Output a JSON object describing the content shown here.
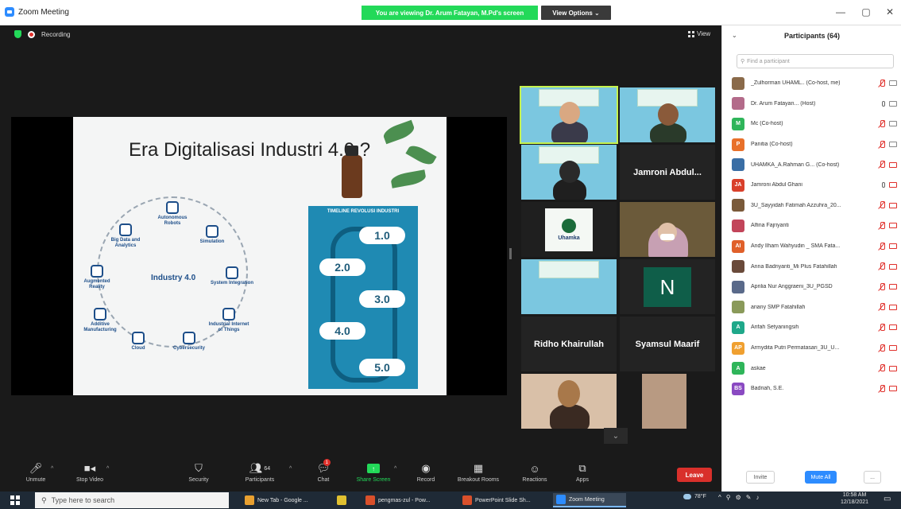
{
  "window": {
    "title": "Zoom Meeting",
    "viewing_banner": "You are viewing Dr. Arum Fatayan, M.Pd's screen",
    "view_options": "View Options ⌄",
    "minimize": "—",
    "maximize": "▢",
    "close": "✕"
  },
  "meeting": {
    "recording_label": "Recording",
    "view_label": "View"
  },
  "slide": {
    "title": "Era Digitalisasi Industri 4.0 ?",
    "center_label": "Industry 4.0",
    "nodes": [
      "Autonomous Robots",
      "Simulation",
      "System Integration",
      "Industrial Internet of Things",
      "Cybersecurity",
      "Cloud",
      "Additive Manufacturing",
      "Augmented Reality",
      "Big Data and Analytics"
    ],
    "timeline_title": "TIMELINE REVOLUSI INDUSTRI",
    "timeline_steps": [
      "1.0",
      "2.0",
      "3.0",
      "4.0",
      "5.0"
    ]
  },
  "tiles": [
    {
      "name": "",
      "type": "video"
    },
    {
      "name": "",
      "type": "video"
    },
    {
      "name": "",
      "type": "video"
    },
    {
      "name": "Jamroni Abdul...",
      "type": "name"
    },
    {
      "name": "",
      "type": "logo"
    },
    {
      "name": "",
      "type": "video"
    },
    {
      "name": "",
      "type": "video"
    },
    {
      "name": "N",
      "type": "avatar"
    },
    {
      "name": "Ridho Khairullah",
      "type": "name"
    },
    {
      "name": "Syamsul Maarif",
      "type": "name"
    },
    {
      "name": "",
      "type": "video"
    },
    {
      "name": "",
      "type": "video"
    }
  ],
  "logo_text": "Uhamka",
  "toolbar": {
    "unmute": "Unmute",
    "stop_video": "Stop Video",
    "security": "Security",
    "participants": "Participants",
    "participants_count": "64",
    "chat": "Chat",
    "chat_badge": "1",
    "share_screen": "Share Screen",
    "record": "Record",
    "breakout_rooms": "Breakout Rooms",
    "reactions": "Reactions",
    "apps": "Apps",
    "leave": "Leave"
  },
  "panel": {
    "title": "Participants (64)",
    "search_placeholder": "Find a participant",
    "invite": "Invite",
    "mute_all": "Mute All",
    "more": "...",
    "participants": [
      {
        "initials": "",
        "name": "_Zulhorman UHAML.. (Co-host, me)",
        "color": "#8a6a4a",
        "mic": "off",
        "cam": "on"
      },
      {
        "initials": "",
        "name": "Dr. Arum Fatayan... (Host)",
        "color": "#b36b8a",
        "mic": "on",
        "cam": "on"
      },
      {
        "initials": "M",
        "name": "Mc (Co-host)",
        "color": "#2fb55a",
        "mic": "off",
        "cam": "on"
      },
      {
        "initials": "P",
        "name": "Panitia (Co-host)",
        "color": "#e8702a",
        "mic": "off",
        "cam": "on"
      },
      {
        "initials": "",
        "name": "UHAMKA_A.Rahman G... (Co-host)",
        "color": "#3a6ea5",
        "mic": "off",
        "cam": "off"
      },
      {
        "initials": "JA",
        "name": "Jamroni Abdul Ghani",
        "color": "#d9402b",
        "mic": "on",
        "cam": "off"
      },
      {
        "initials": "",
        "name": "3U_Sayyidah Fatimah Azzuhra_20...",
        "color": "#7a5a3a",
        "mic": "off",
        "cam": "off"
      },
      {
        "initials": "",
        "name": "Alfina Fajriyanti",
        "color": "#c2455a",
        "mic": "off",
        "cam": "off"
      },
      {
        "initials": "AI",
        "name": "Andy Ilham Wahyudin _ SMA Fata...",
        "color": "#e0602a",
        "mic": "off",
        "cam": "off"
      },
      {
        "initials": "",
        "name": "Anna Badriyanti_Mi Plus Fatahillah",
        "color": "#6a4a3a",
        "mic": "off",
        "cam": "off"
      },
      {
        "initials": "",
        "name": "Aprilia Nur Anggraeni_3U_PGSD",
        "color": "#5a6a8a",
        "mic": "off",
        "cam": "off"
      },
      {
        "initials": "",
        "name": "ariany SMP Fatahillah",
        "color": "#8a9a5a",
        "mic": "off",
        "cam": "off"
      },
      {
        "initials": "A",
        "name": "Arifah Setyaningsih",
        "color": "#1fa88a",
        "mic": "off",
        "cam": "off"
      },
      {
        "initials": "AP",
        "name": "Armydita Putri Permatasari_3U_U...",
        "color": "#f0a030",
        "mic": "off",
        "cam": "off"
      },
      {
        "initials": "A",
        "name": "askae",
        "color": "#2fb55a",
        "mic": "off",
        "cam": "off"
      },
      {
        "initials": "BS",
        "name": "Badriah, S.E.",
        "color": "#8a4ac2",
        "mic": "off",
        "cam": "off"
      }
    ]
  },
  "taskbar": {
    "search_placeholder": "Type here to search",
    "apps": [
      {
        "label": "New Tab - Google ...",
        "color": "#e8a030",
        "active": false
      },
      {
        "label": "",
        "color": "#e0c030",
        "active": false
      },
      {
        "label": "pengmas-zul - Pow...",
        "color": "#d9502b",
        "active": false
      },
      {
        "label": "PowerPoint Slide Sh...",
        "color": "#d9502b",
        "active": false
      },
      {
        "label": "Zoom Meeting",
        "color": "#2d8cff",
        "active": true
      }
    ],
    "weather": "78°F",
    "time": "10:58 AM",
    "date": "12/18/2021"
  }
}
